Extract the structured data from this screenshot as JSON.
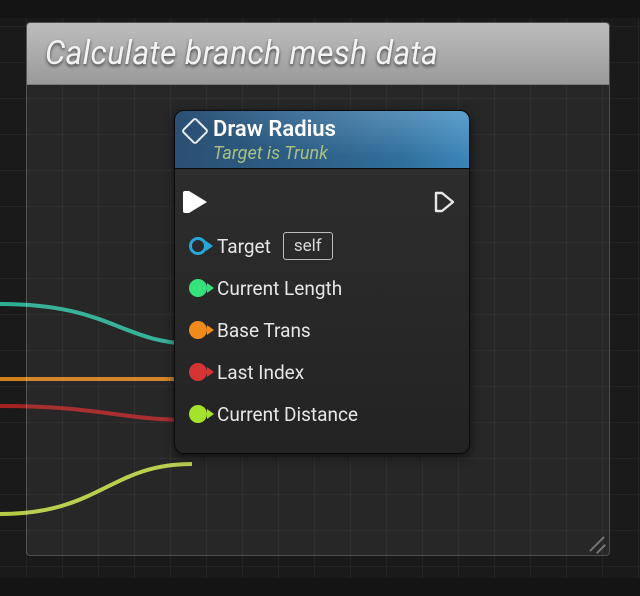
{
  "comment": {
    "title": "Calculate branch mesh data"
  },
  "node": {
    "title": "Draw Radius",
    "subtitle": "Target is Trunk",
    "inputs": {
      "target": {
        "label": "Target",
        "self_chip": "self"
      },
      "currentLength": {
        "label": "Current Length"
      },
      "baseTrans": {
        "label": "Base Trans"
      },
      "lastIndex": {
        "label": "Last Index"
      },
      "currentDistance": {
        "label": "Current Distance"
      }
    }
  },
  "colors": {
    "targetPin": "#27a7d8",
    "floatPin": "#36e07a",
    "transformPin": "#f08a1a",
    "intPin": "#d63434",
    "wire_float": "#2fbf9f",
    "wire_transform": "#e88a1e",
    "wire_int": "#b22424",
    "wire_float2": "#c7e04a"
  }
}
